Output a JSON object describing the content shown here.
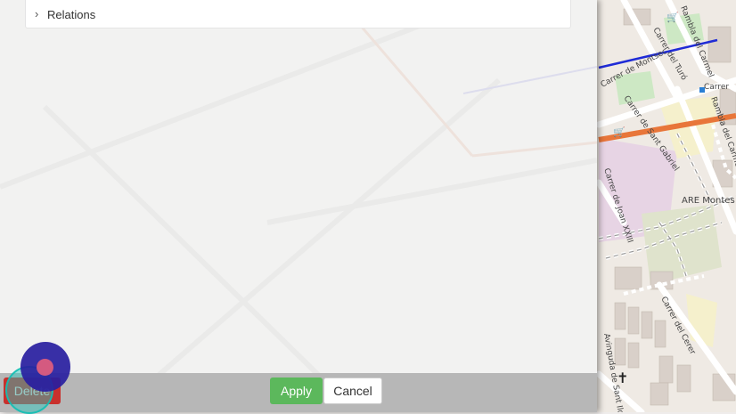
{
  "panel": {
    "relations_label": "Relations",
    "chevron_glyph": "›"
  },
  "bottom_bar": {
    "delete_label": "Delete",
    "apply_label": "Apply",
    "cancel_label": "Cancel"
  },
  "map": {
    "labels": {
      "rambla_del_carmel": "Rambla del Carmel",
      "carrer_del_turo": "Carrer del Turó",
      "carrer_montsec": "Carrer de Montsec",
      "carrer_sant_gabriel": "Carrer de Sant Gabriel",
      "carrer_joan_xxiii": "Carrer de Joan XXIII",
      "rambla_carmel_2": "Rambla del Carmel",
      "are_montesori": "ARE Montes",
      "carrer_cerer": "Carrer del Cerer",
      "carrer_short": "Carrer",
      "av_sant_ildefons": "Avinguda de Sant Ild"
    }
  },
  "colors": {
    "delete_bg": "#c9302c",
    "apply_bg": "#5cb85c",
    "road_orange": "#e8763a",
    "road_blue": "#1f2bd6",
    "park_green": "#cde8c4",
    "residential_pink": "#e7d4e4",
    "touch_blue": "#281ea0",
    "touch_teal": "#28c8be"
  }
}
